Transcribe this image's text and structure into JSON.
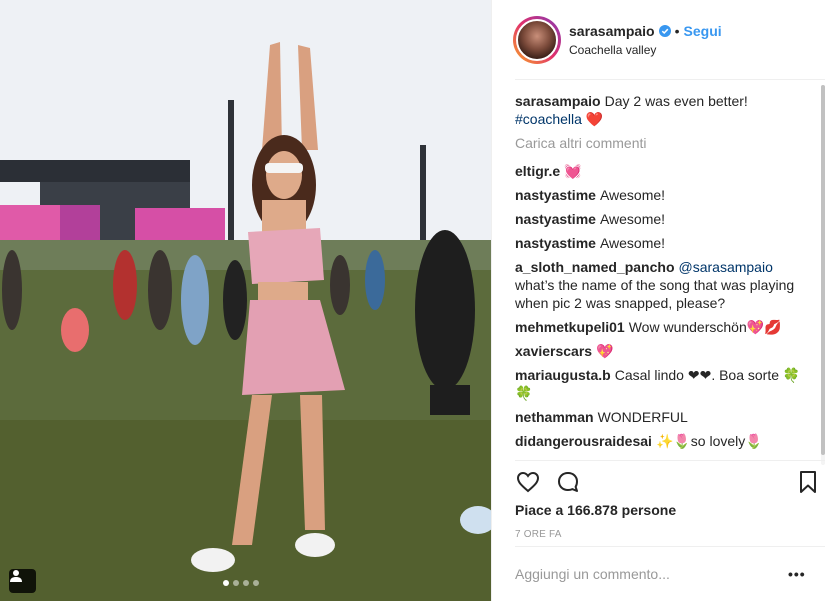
{
  "post": {
    "username": "sarasampaio",
    "separator": "•",
    "follow_label": "Segui",
    "location": "Coachella valley",
    "caption_user": "sarasampaio",
    "caption_text": "Day 2 was even better!",
    "caption_hashtag": "#coachella",
    "caption_emoji": "❤️",
    "load_more_label": "Carica altri commenti",
    "comments": [
      {
        "user": "eltigr.e",
        "text": "💓"
      },
      {
        "user": "nastyastime",
        "text": "Awesome!"
      },
      {
        "user": "nastyastime",
        "text": "Awesome!"
      },
      {
        "user": "nastyastime",
        "text": "Awesome!"
      },
      {
        "user": "a_sloth_named_pancho",
        "mention": "@sarasampaio",
        "text": "what’s the name of the song that was playing when pic 2 was snapped, please?"
      },
      {
        "user": "mehmetkupeli01",
        "text": "Wow wunderschön💖💋"
      },
      {
        "user": "xavierscars",
        "text": "💖"
      },
      {
        "user": "mariaugusta.b",
        "text": "Casal lindo ❤❤. Boa sorte 🍀🍀"
      },
      {
        "user": "nethamman",
        "text": "WONDERFUL"
      },
      {
        "user": "didangerousraidesai",
        "text": "✨🌷so lovely🌷"
      }
    ],
    "likes_text": "Piace a 166.878 persone",
    "time_text": "7 ORE FA",
    "add_comment_placeholder": "Aggiungi un commento...",
    "more_label": "•••"
  },
  "icons": {
    "verified": "verified-badge-icon",
    "like": "heart-icon",
    "comment": "comment-icon",
    "save": "bookmark-icon",
    "user_tag": "user-tag-icon"
  },
  "colors": {
    "accent": "#3897f0",
    "hashtag": "#003569",
    "muted": "#999999",
    "text": "#262626"
  },
  "carousel": {
    "total": 4,
    "active_index": 0
  }
}
